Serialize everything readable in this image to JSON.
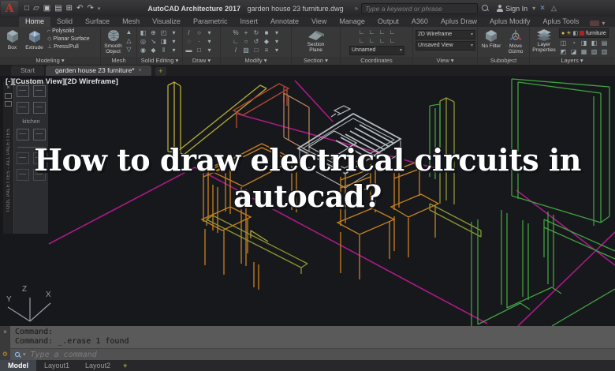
{
  "titlebar": {
    "app_title": "AutoCAD Architecture 2017",
    "doc_title": "garden house 23 furniture.dwg",
    "search_placeholder": "Type a keyword or phrase",
    "sign_in": "Sign In"
  },
  "icons": {
    "caret_down": "▾",
    "close": "×",
    "plus": "+",
    "keyword_sep": "»",
    "help_tri": "△",
    "qat": [
      "□",
      "▱",
      "▣",
      "▤",
      "⊞",
      "↶",
      "↷",
      "▾"
    ]
  },
  "ribbon": {
    "active_tab": 0,
    "tabs": [
      "Home",
      "Solid",
      "Surface",
      "Mesh",
      "Visualize",
      "Parametric",
      "Insert",
      "Annotate",
      "View",
      "Manage",
      "Output",
      "A360",
      "Aplus Draw",
      "Aplus Modify",
      "Aplus Tools"
    ]
  },
  "panels": {
    "modeling": {
      "label": "Modeling",
      "box": "Box",
      "extrude": "Extrude",
      "rows": [
        "Polysolid",
        "Planar Surface",
        "Press/Pull"
      ]
    },
    "mesh": {
      "label": "Mesh",
      "smooth": "Smooth\nObject",
      "icons": [
        [
          "▲"
        ],
        [
          "△"
        ],
        [
          "▽"
        ]
      ]
    },
    "solid_editing": {
      "label": "Solid Editing",
      "icons": [
        [
          "◧",
          "⊕",
          "◰",
          "▾"
        ],
        [
          "◎",
          "↘",
          "◨",
          "▾"
        ],
        [
          "◉",
          "◆",
          "‖",
          "▾"
        ]
      ]
    },
    "draw": {
      "label": "Draw",
      "icons": [
        [
          "/",
          "○",
          "▾"
        ],
        [
          "◌",
          "·",
          "▾"
        ],
        [
          "▬",
          "□",
          "▾"
        ]
      ]
    },
    "modify": {
      "label": "Modify",
      "icons": [
        [
          "%",
          "+",
          "↻",
          "■",
          "▾"
        ],
        [
          "∟",
          "○",
          "↺",
          "◆",
          "▾"
        ],
        [
          "/",
          "▨",
          "□",
          "≡",
          "▾"
        ]
      ]
    },
    "section": {
      "label": "Section",
      "plane": "Section\nPlane"
    },
    "coordinates": {
      "label": "Coordinates",
      "unnamed": "Unnamed",
      "icons": [
        [
          "∟",
          "∟",
          "∟",
          "∟"
        ],
        [
          "∟",
          "∟",
          "∟",
          "∟"
        ]
      ]
    },
    "view": {
      "label": "View",
      "visual_style": "2D Wireframe",
      "saved_view": "Unsaved View"
    },
    "subobject": {
      "label": "Subobject",
      "no_filter": "No Filter",
      "move_gizmo": "Move\nGizmo"
    },
    "layers": {
      "label": "Layers",
      "layer_properties": "Layer\nProperties",
      "current_layer": "furniture",
      "icons": [
        [
          "◫",
          "◔",
          "◨",
          "◧",
          "▤"
        ],
        [
          "◩",
          "◪",
          "▦",
          "▧",
          "▥"
        ]
      ]
    }
  },
  "doc_tabs": {
    "start": "Start",
    "active": "garden house 23 furniture*"
  },
  "viewport": {
    "controls": "[-][Custom View][2D Wireframe]"
  },
  "palette": {
    "title": "TOOL PALETTES - ALL PALETTES",
    "group": "kitchen"
  },
  "overlay": {
    "line1": "How to draw electrical circuits in",
    "line2": "autocad?"
  },
  "ucs": {
    "x": "X",
    "y": "Y",
    "z": "Z"
  },
  "command": {
    "history": [
      "Command:",
      "Command: _.erase 1 found"
    ],
    "placeholder": "Type a command"
  },
  "layout_tabs": {
    "model": "Model",
    "layout1": "Layout1",
    "layout2": "Layout2"
  },
  "colors": {
    "magenta": "#ab1a86",
    "orange": "#c8811f",
    "green": "#3fa33f",
    "olive": "#8f9632",
    "yellow": "#b5ae38",
    "sink": "#b6bfc2",
    "darkred": "#b04832",
    "salmon": "#c08a60",
    "canvas_bg": "#17181c",
    "layer_swatch": "#b02020"
  }
}
